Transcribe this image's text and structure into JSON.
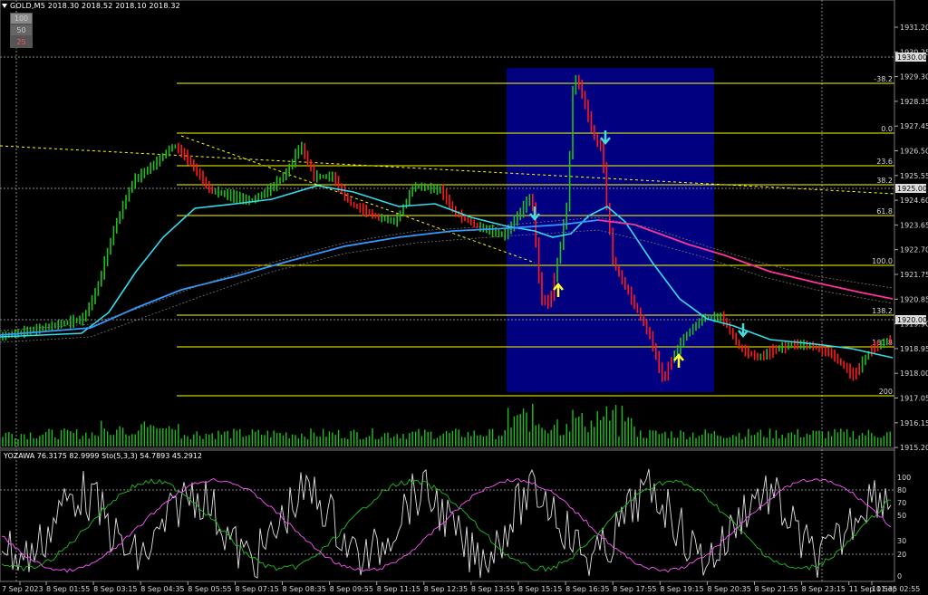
{
  "header": {
    "symbol_line": "GOLD,M5  2018.30 2018.52 2018.10 2018.32",
    "level_buttons": [
      "100",
      "50",
      "25"
    ]
  },
  "indicator_header": "YOZAWA 76.3175 82.9999  Sto(5,3,3) 54.7893 45.2912",
  "price_axis": {
    "ticks": [
      "1931.20",
      "1930.25",
      "1929.30",
      "1928.35",
      "1927.45",
      "1926.50",
      "1925.55",
      "1924.60",
      "1923.65",
      "1922.70",
      "1921.75",
      "1920.85",
      "1919.90",
      "1918.95",
      "1918.00",
      "1917.05",
      "1916.15",
      "1915.20"
    ],
    "current_price": "1925.00",
    "level_1930": "1930.00",
    "level_1920": "1920.00"
  },
  "indicator_axis": {
    "ticks": [
      "100",
      "80",
      "70",
      "50",
      "30",
      "20",
      "0"
    ]
  },
  "time_axis": {
    "ticks": [
      "7 Sep 2023",
      "8 Sep 01:55",
      "8 Sep 03:15",
      "8 Sep 04:35",
      "8 Sep 05:55",
      "8 Sep 07:15",
      "8 Sep 08:35",
      "8 Sep 09:55",
      "8 Sep 11:15",
      "8 Sep 12:35",
      "8 Sep 13:55",
      "8 Sep 15:15",
      "8 Sep 16:35",
      "8 Sep 17:55",
      "8 Sep 19:15",
      "8 Sep 20:35",
      "8 Sep 21:55",
      "8 Sep 23:15",
      "11 Sep 01:35",
      "11 Sep 02:55"
    ]
  },
  "fibonacci": {
    "levels": [
      "-38.2",
      "0.0",
      "23.6",
      "38.2",
      "61.8",
      "100.0",
      "138.2",
      "161.8",
      "200"
    ]
  },
  "colors": {
    "bull": "#1fbf1f",
    "bear": "#ff1a1a",
    "fib": "#ffff00",
    "ma_fast": "#33ddee",
    "ma_slow": "#3399ff",
    "ma_pink": "#ff3399",
    "highlight_box": "#000080",
    "arrow_down": "#44dddd",
    "arrow_up": "#ffff33"
  }
}
